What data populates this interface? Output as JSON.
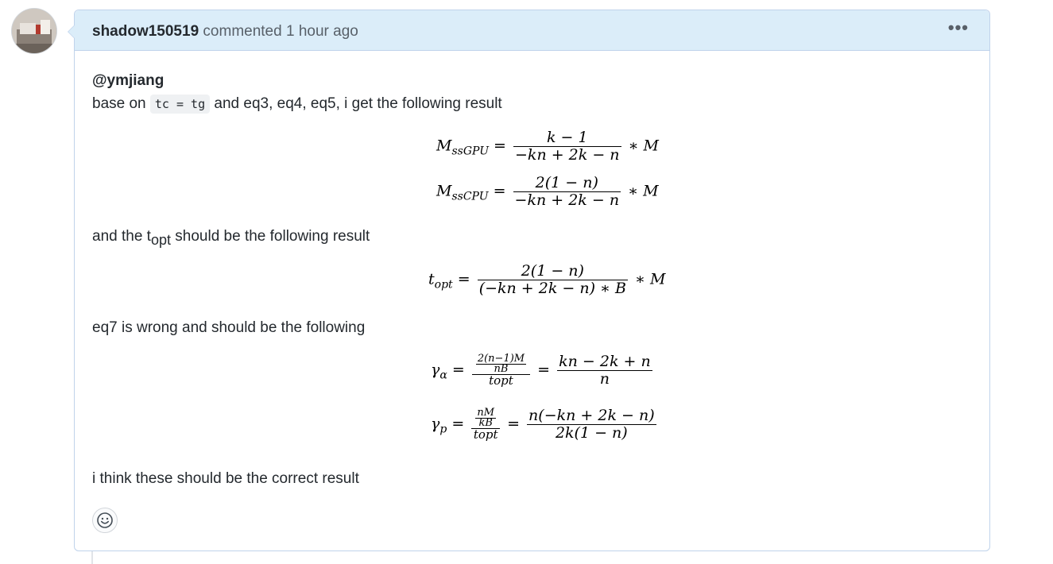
{
  "comment": {
    "author": "shadow150519",
    "action": "commented",
    "time": "1 hour ago",
    "more_label": "•••"
  },
  "body": {
    "mention": "@ymjiang",
    "line1_prefix": "base on",
    "line1_code": "tc = tg",
    "line1_suffix": "and eq3, eq4, eq5, i get the following result",
    "line2_prefix": "and the t",
    "line2_sub": "opt",
    "line2_suffix": "should be the following result",
    "line3": "eq7 is wrong and should be the following",
    "line4": "i think these should be the correct result"
  },
  "equations": {
    "eq1": {
      "lhs_base": "M",
      "lhs_sub": "ssGPU",
      "num": "k − 1",
      "den": "−kn + 2k − n",
      "tail": "∗ M"
    },
    "eq2": {
      "lhs_base": "M",
      "lhs_sub": "ssCPU",
      "num": "2(1 − n)",
      "den": "−kn + 2k − n",
      "tail": "∗ M"
    },
    "eq3": {
      "lhs_base": "t",
      "lhs_sub": "opt",
      "num": "2(1 − n)",
      "den": "(−kn + 2k − n) ∗ B",
      "tail": "∗ M"
    },
    "eq4": {
      "lhs_base": "γ",
      "lhs_sub": "α",
      "inner_num": "2(n−1)M",
      "inner_den": "nB",
      "outer_den": "topt",
      "rhs_num": "kn − 2k + n",
      "rhs_den": "n"
    },
    "eq5": {
      "lhs_base": "γ",
      "lhs_sub": "p",
      "inner_num": "nM",
      "inner_den": "kB",
      "outer_den": "topt",
      "rhs_num": "n(−kn + 2k − n)",
      "rhs_den": "2k(1 − n)"
    }
  },
  "reaction": {
    "icon": "smiley-icon"
  }
}
